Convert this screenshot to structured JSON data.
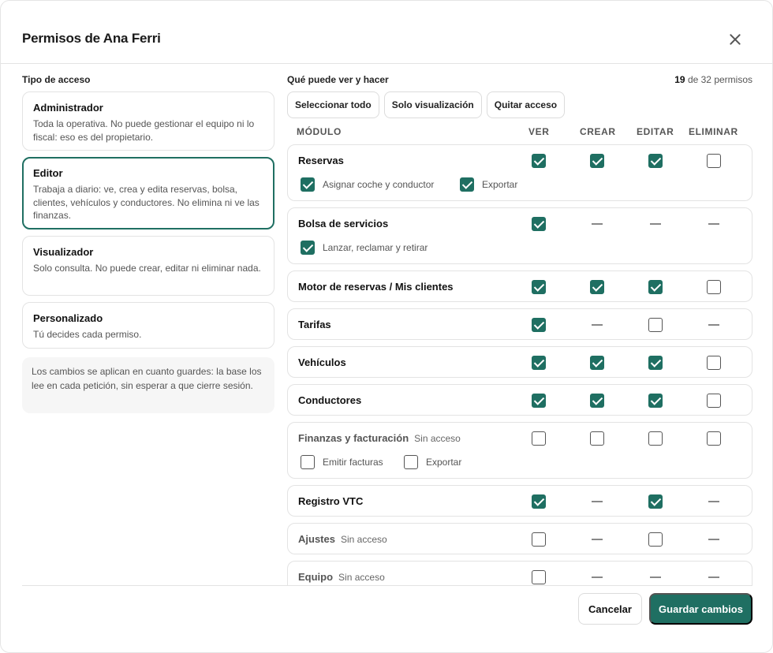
{
  "dialog": {
    "title": "Permisos de Ana Ferri",
    "close_icon": "close-icon"
  },
  "left": {
    "section_label": "Tipo de acceso",
    "options": [
      {
        "title": "Administrador",
        "desc": "Toda la operativa. No puede gestionar el equipo ni lo fiscal: eso es del propietario.",
        "selected": false
      },
      {
        "title": "Editor",
        "desc": "Trabaja a diario: ve, crea y edita reservas, bolsa, clientes, vehículos y conductores. No elimina ni ve las finanzas.",
        "selected": true
      },
      {
        "title": "Visualizador",
        "desc": "Solo consulta. No puede crear, editar ni eliminar nada.",
        "selected": false
      },
      {
        "title": "Personalizado",
        "desc": "Tú decides cada permiso.",
        "selected": false
      }
    ],
    "note": "Los cambios se aplican en cuanto guardes: la base los lee en cada petición, sin esperar a que cierre sesión."
  },
  "right": {
    "section_label": "Qué puede ver y hacer",
    "count_value": "19",
    "count_suffix": "de 32 permisos",
    "buttons": {
      "select_all": "Seleccionar todo",
      "view_only": "Solo visualización",
      "remove_access": "Quitar acceso"
    },
    "columns": {
      "module": "MÓDULO",
      "view": "VER",
      "create": "CREAR",
      "edit": "EDITAR",
      "delete": "ELIMINAR"
    },
    "modules": [
      {
        "name": "Reservas",
        "sub": "",
        "disabled": false,
        "perms": [
          "on",
          "on",
          "on",
          "off"
        ],
        "extras": [
          {
            "label": "Asignar coche y conductor",
            "checked": true
          },
          {
            "label": "Exportar",
            "checked": true
          }
        ]
      },
      {
        "name": "Bolsa de servicios",
        "sub": "",
        "disabled": false,
        "perms": [
          "on",
          "dash",
          "dash",
          "dash"
        ],
        "extras": [
          {
            "label": "Lanzar, reclamar y retirar",
            "checked": true
          }
        ]
      },
      {
        "name": "Motor de reservas / Mis clientes",
        "sub": "",
        "disabled": false,
        "perms": [
          "on",
          "on",
          "on",
          "off"
        ],
        "extras": []
      },
      {
        "name": "Tarifas",
        "sub": "",
        "disabled": false,
        "perms": [
          "on",
          "dash",
          "off",
          "dash"
        ],
        "extras": []
      },
      {
        "name": "Vehículos",
        "sub": "",
        "disabled": false,
        "perms": [
          "on",
          "on",
          "on",
          "off"
        ],
        "extras": []
      },
      {
        "name": "Conductores",
        "sub": "",
        "disabled": false,
        "perms": [
          "on",
          "on",
          "on",
          "off"
        ],
        "extras": []
      },
      {
        "name": "Finanzas y facturación",
        "sub": "Sin acceso",
        "disabled": true,
        "perms": [
          "off",
          "off",
          "off",
          "off"
        ],
        "extras": [
          {
            "label": "Emitir facturas",
            "checked": false
          },
          {
            "label": "Exportar",
            "checked": false
          }
        ]
      },
      {
        "name": "Registro VTC",
        "sub": "",
        "disabled": false,
        "perms": [
          "on",
          "dash",
          "on",
          "dash"
        ],
        "extras": []
      },
      {
        "name": "Ajustes",
        "sub": "Sin acceso",
        "disabled": true,
        "perms": [
          "off",
          "dash",
          "off",
          "dash"
        ],
        "extras": []
      },
      {
        "name": "Equipo",
        "sub": "Sin acceso",
        "disabled": true,
        "perms": [
          "off",
          "dash",
          "dash",
          "dash"
        ],
        "extras": []
      }
    ]
  },
  "footer": {
    "cancel": "Cancelar",
    "save": "Guardar cambios"
  },
  "colors": {
    "accent": "#1f6f62",
    "border": "#e3e3e3",
    "note_bg": "#f6f6f6"
  }
}
